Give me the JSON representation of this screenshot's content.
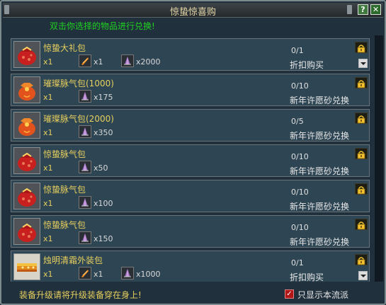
{
  "window": {
    "title": "惊蛰惊喜购",
    "help_label": "?",
    "close_label": "✕",
    "hint": "双击你选择的物品进行兑换!"
  },
  "items": [
    {
      "name": "惊蛰大礼包",
      "icon": "red-bag-icon",
      "qty": "x1",
      "materials": [
        {
          "icon": "orange-feather-icon",
          "qty": "x1"
        },
        {
          "icon": "purple-crystal-icon",
          "qty": "x2000"
        }
      ],
      "count": "0/1",
      "method": "折扣购买",
      "has_dropdown": true
    },
    {
      "name": "璀璨脉气包(1000)",
      "icon": "orange-bag-icon",
      "qty": "x1",
      "materials": [
        {
          "icon": "purple-crystal-icon",
          "qty": "x175"
        }
      ],
      "count": "0/10",
      "method": "新年许愿砂兑换",
      "has_dropdown": false
    },
    {
      "name": "璀璨脉气包(2000)",
      "icon": "orange-bag-icon",
      "qty": "x1",
      "materials": [
        {
          "icon": "purple-crystal-icon",
          "qty": "x350"
        }
      ],
      "count": "0/5",
      "method": "新年许愿砂兑换",
      "has_dropdown": false
    },
    {
      "name": "惊蛰脉气包",
      "icon": "red-bag-icon",
      "qty": "x1",
      "materials": [
        {
          "icon": "purple-crystal-icon",
          "qty": "x50"
        }
      ],
      "count": "0/10",
      "method": "新年许愿砂兑换",
      "has_dropdown": false
    },
    {
      "name": "惊蛰脉气包",
      "icon": "red-bag-icon",
      "qty": "x1",
      "materials": [
        {
          "icon": "purple-crystal-icon",
          "qty": "x100"
        }
      ],
      "count": "0/10",
      "method": "新年许愿砂兑换",
      "has_dropdown": false
    },
    {
      "name": "惊蛰脉气包",
      "icon": "red-bag-icon",
      "qty": "x1",
      "materials": [
        {
          "icon": "purple-crystal-icon",
          "qty": "x150"
        }
      ],
      "count": "0/10",
      "method": "新年许愿砂兑换",
      "has_dropdown": false
    },
    {
      "name": "烛明清霜外装包",
      "icon": "outfit-box-icon",
      "qty": "x1",
      "materials": [
        {
          "icon": "orange-feather-icon",
          "qty": "x1"
        },
        {
          "icon": "purple-crystal-icon",
          "qty": "x1000"
        }
      ],
      "count": "0/1",
      "method": "折扣购买",
      "has_dropdown": true
    }
  ],
  "footer": {
    "tip": "装备升级请将升级装备穿在身上!",
    "show_school_label": "只显示本流派",
    "show_school_checked": true,
    "check_mark": "✓"
  }
}
